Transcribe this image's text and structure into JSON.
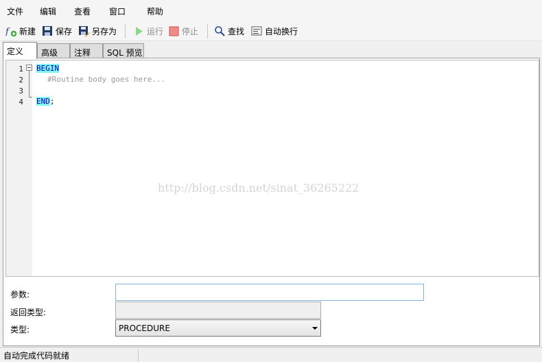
{
  "menu": {
    "file": "文件",
    "edit": "编辑",
    "view": "查看",
    "window": "窗口",
    "help": "帮助"
  },
  "toolbar": {
    "new_label": "新建",
    "new_icon": "function-new-icon",
    "save_label": "保存",
    "save_icon": "floppy-disk-icon",
    "save_as_label": "另存为",
    "save_as_icon": "floppy-disk-pencil-icon",
    "run_label": "运行",
    "run_icon": "play-icon",
    "stop_label": "停止",
    "stop_icon": "stop-icon",
    "find_label": "查找",
    "find_icon": "magnifier-icon",
    "wrap_label": "自动换行",
    "wrap_icon": "word-wrap-icon"
  },
  "tabs": {
    "definition": "定义",
    "advanced": "高级",
    "comment": "注释",
    "sql_preview": "SQL 预览",
    "active": "定义"
  },
  "editor": {
    "line_numbers": [
      "1",
      "2",
      "3",
      "4"
    ],
    "begin_keyword": "BEGIN",
    "comment_line": "#Routine body goes here...",
    "end_keyword": "END",
    "end_punct": ";",
    "keyword_highlight_color": "#7ff4f4"
  },
  "watermark": "http://blog.csdn.net/sinat_36265222",
  "form": {
    "params_label": "参数:",
    "params_value": "",
    "return_type_label": "返回类型:",
    "return_type_value": "",
    "type_label": "类型:",
    "type_value": "PROCEDURE"
  },
  "status": {
    "message": "自动完成代码就绪"
  }
}
